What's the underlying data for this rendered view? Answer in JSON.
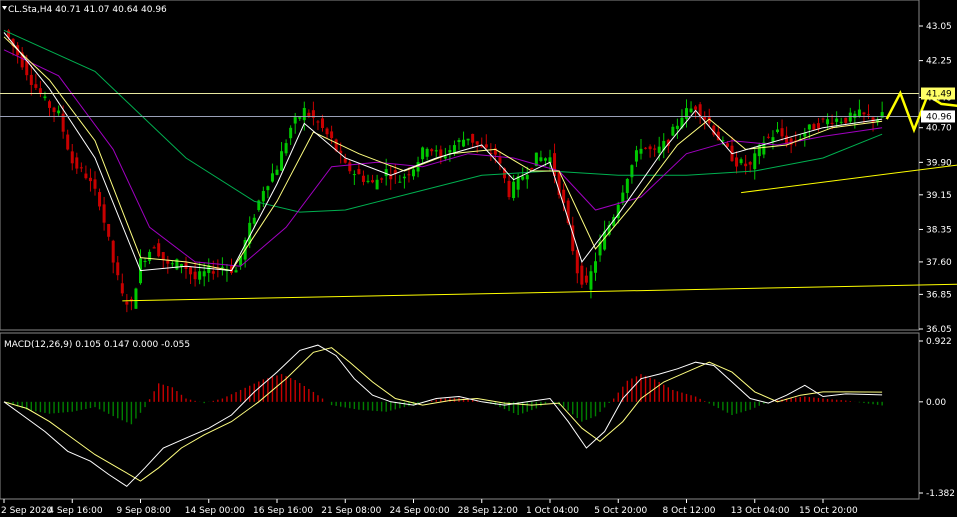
{
  "header": {
    "symbol_line": "CL.Sta,H4  40.71 41.07 40.64 40.96"
  },
  "macd_header": {
    "text": "MACD(12,26,9) 0.105 0.147 0.000 -0.055"
  },
  "colors": {
    "background": "#000000",
    "frame": "#ffffff",
    "bull": "#00c800",
    "bear": "#c80000",
    "ma_fast": "#ffffff",
    "ma_mid": "#ffff80",
    "ma_slow": "#a000c0",
    "ma_long": "#00b050",
    "trend": "#ffff00",
    "hline": "#e8e8a0",
    "projection": "#ffff00",
    "macd_pos": "#c80000",
    "macd_neg": "#008000",
    "macd_line": "#ffffff",
    "signal_line": "#ffff80"
  },
  "chart_data": [
    {
      "type": "candlestick",
      "name_text": "CL.Sta,H4",
      "ylim": [
        36.05,
        43.05
      ],
      "yticks": [
        "43.05",
        "42.25",
        "41.40",
        "40.70",
        "39.90",
        "39.15",
        "38.35",
        "37.60",
        "36.85",
        "36.05"
      ],
      "ytick_values": [
        43.05,
        42.25,
        41.4,
        40.7,
        39.9,
        39.15,
        38.35,
        37.6,
        36.85,
        36.05
      ],
      "price_labels": [
        {
          "value": 41.49,
          "text": "41.49",
          "style": "hline"
        },
        {
          "value": 40.96,
          "text": "40.96",
          "style": "current"
        }
      ],
      "xticks": [
        "2 Sep 2020",
        "4 Sep 16:00",
        "9 Sep 08:00",
        "14 Sep 00:00",
        "16 Sep 16:00",
        "21 Sep 08:00",
        "24 Sep 00:00",
        "28 Sep 12:00",
        "1 Oct 04:00",
        "5 Oct 20:00",
        "8 Oct 12:00",
        "13 Oct 04:00",
        "15 Oct 20:00"
      ],
      "xtick_index": [
        0,
        15,
        30,
        45,
        60,
        75,
        90,
        105,
        120,
        135,
        150,
        165,
        180
      ],
      "close_path": [
        [
          0,
          42.95
        ],
        [
          3,
          42.4
        ],
        [
          6,
          41.8
        ],
        [
          9,
          41.3
        ],
        [
          12,
          41.0
        ],
        [
          15,
          39.9
        ],
        [
          18,
          39.6
        ],
        [
          21,
          39.0
        ],
        [
          24,
          37.6
        ],
        [
          26,
          36.8
        ],
        [
          28,
          36.6
        ],
        [
          30,
          37.6
        ],
        [
          33,
          38.0
        ],
        [
          36,
          37.5
        ],
        [
          39,
          37.6
        ],
        [
          42,
          37.2
        ],
        [
          45,
          37.4
        ],
        [
          48,
          37.5
        ],
        [
          51,
          37.4
        ],
        [
          54,
          38.4
        ],
        [
          57,
          39.3
        ],
        [
          60,
          39.8
        ],
        [
          63,
          40.7
        ],
        [
          66,
          41.1
        ],
        [
          69,
          40.8
        ],
        [
          72,
          40.4
        ],
        [
          75,
          39.8
        ],
        [
          78,
          39.6
        ],
        [
          81,
          39.4
        ],
        [
          84,
          39.7
        ],
        [
          87,
          39.5
        ],
        [
          90,
          39.8
        ],
        [
          93,
          40.3
        ],
        [
          96,
          40.0
        ],
        [
          99,
          40.3
        ],
        [
          102,
          40.5
        ],
        [
          105,
          40.2
        ],
        [
          108,
          40.1
        ],
        [
          111,
          39.2
        ],
        [
          114,
          39.6
        ],
        [
          117,
          40.0
        ],
        [
          120,
          40.0
        ],
        [
          123,
          38.9
        ],
        [
          126,
          37.4
        ],
        [
          128,
          37.0
        ],
        [
          131,
          38.0
        ],
        [
          134,
          38.7
        ],
        [
          137,
          39.6
        ],
        [
          140,
          40.3
        ],
        [
          143,
          40.1
        ],
        [
          146,
          40.4
        ],
        [
          149,
          41.0
        ],
        [
          152,
          41.2
        ],
        [
          155,
          40.8
        ],
        [
          158,
          40.3
        ],
        [
          161,
          39.9
        ],
        [
          164,
          39.8
        ],
        [
          167,
          40.4
        ],
        [
          170,
          40.6
        ],
        [
          173,
          40.3
        ],
        [
          176,
          40.6
        ],
        [
          179,
          40.8
        ],
        [
          182,
          40.9
        ],
        [
          185,
          40.9
        ],
        [
          188,
          41.0
        ],
        [
          191,
          40.9
        ],
        [
          193,
          40.96
        ]
      ],
      "ma_fast_path": [
        [
          0,
          42.9
        ],
        [
          10,
          41.6
        ],
        [
          20,
          40.0
        ],
        [
          30,
          37.4
        ],
        [
          40,
          37.5
        ],
        [
          50,
          37.4
        ],
        [
          60,
          39.4
        ],
        [
          66,
          40.8
        ],
        [
          75,
          40.0
        ],
        [
          85,
          39.6
        ],
        [
          95,
          40.0
        ],
        [
          105,
          40.3
        ],
        [
          112,
          39.5
        ],
        [
          120,
          39.9
        ],
        [
          127,
          37.6
        ],
        [
          135,
          38.7
        ],
        [
          145,
          40.2
        ],
        [
          152,
          41.1
        ],
        [
          160,
          40.1
        ],
        [
          170,
          40.4
        ],
        [
          180,
          40.7
        ],
        [
          193,
          40.9
        ]
      ],
      "ma_mid_path": [
        [
          0,
          42.8
        ],
        [
          10,
          41.8
        ],
        [
          20,
          40.4
        ],
        [
          30,
          37.7
        ],
        [
          40,
          37.6
        ],
        [
          50,
          37.4
        ],
        [
          60,
          39.0
        ],
        [
          68,
          40.6
        ],
        [
          78,
          40.1
        ],
        [
          88,
          39.7
        ],
        [
          98,
          40.1
        ],
        [
          108,
          40.2
        ],
        [
          116,
          39.7
        ],
        [
          122,
          39.7
        ],
        [
          130,
          37.9
        ],
        [
          138,
          38.9
        ],
        [
          148,
          40.3
        ],
        [
          155,
          40.9
        ],
        [
          163,
          40.2
        ],
        [
          172,
          40.3
        ],
        [
          182,
          40.7
        ],
        [
          193,
          40.85
        ]
      ],
      "ma_slow_path": [
        [
          0,
          42.5
        ],
        [
          12,
          41.9
        ],
        [
          24,
          40.2
        ],
        [
          32,
          38.4
        ],
        [
          42,
          37.6
        ],
        [
          52,
          37.5
        ],
        [
          62,
          38.4
        ],
        [
          72,
          39.8
        ],
        [
          82,
          39.9
        ],
        [
          92,
          39.8
        ],
        [
          102,
          40.1
        ],
        [
          112,
          40.0
        ],
        [
          122,
          39.7
        ],
        [
          130,
          38.8
        ],
        [
          140,
          39.1
        ],
        [
          150,
          40.1
        ],
        [
          160,
          40.4
        ],
        [
          170,
          40.3
        ],
        [
          180,
          40.5
        ],
        [
          193,
          40.7
        ]
      ],
      "ma_long_path": [
        [
          0,
          42.95
        ],
        [
          20,
          42.0
        ],
        [
          40,
          40.0
        ],
        [
          55,
          39.0
        ],
        [
          65,
          38.75
        ],
        [
          75,
          38.8
        ],
        [
          90,
          39.2
        ],
        [
          105,
          39.6
        ],
        [
          120,
          39.7
        ],
        [
          135,
          39.6
        ],
        [
          150,
          39.6
        ],
        [
          165,
          39.7
        ],
        [
          180,
          40.0
        ],
        [
          193,
          40.55
        ]
      ],
      "trend_lines": [
        [
          [
            26,
            36.7
          ],
          [
            218,
            37.1
          ]
        ],
        [
          [
            162,
            39.2
          ],
          [
            218,
            39.95
          ]
        ]
      ],
      "hlines": [
        41.49,
        40.96
      ],
      "projection_path": [
        [
          194,
          40.9
        ],
        [
          197,
          41.5
        ],
        [
          200,
          40.65
        ],
        [
          203,
          41.45
        ],
        [
          206,
          41.25
        ],
        [
          210,
          41.2
        ],
        [
          214,
          41.75
        ]
      ]
    },
    {
      "type": "macd",
      "ylim": [
        -1.382,
        0.922
      ],
      "yticks": [
        "0.922",
        "0.00",
        "-1.382"
      ],
      "ytick_values": [
        0.922,
        0.0,
        -1.382
      ],
      "hist_path": [
        [
          0,
          0.0
        ],
        [
          5,
          -0.12
        ],
        [
          10,
          -0.18
        ],
        [
          15,
          -0.15
        ],
        [
          20,
          -0.08
        ],
        [
          25,
          -0.25
        ],
        [
          28,
          -0.34
        ],
        [
          31,
          -0.08
        ],
        [
          34,
          0.28
        ],
        [
          37,
          0.22
        ],
        [
          40,
          0.05
        ],
        [
          44,
          -0.02
        ],
        [
          48,
          0.05
        ],
        [
          52,
          0.18
        ],
        [
          57,
          0.34
        ],
        [
          61,
          0.42
        ],
        [
          64,
          0.33
        ],
        [
          68,
          0.15
        ],
        [
          72,
          -0.05
        ],
        [
          78,
          -0.12
        ],
        [
          84,
          -0.15
        ],
        [
          88,
          -0.08
        ],
        [
          92,
          -0.02
        ],
        [
          96,
          0.05
        ],
        [
          100,
          0.06
        ],
        [
          104,
          0.02
        ],
        [
          108,
          -0.05
        ],
        [
          113,
          -0.2
        ],
        [
          117,
          -0.1
        ],
        [
          120,
          0.0
        ],
        [
          123,
          -0.08
        ],
        [
          127,
          -0.3
        ],
        [
          130,
          -0.22
        ],
        [
          134,
          0.05
        ],
        [
          137,
          0.32
        ],
        [
          140,
          0.42
        ],
        [
          143,
          0.34
        ],
        [
          147,
          0.18
        ],
        [
          152,
          0.08
        ],
        [
          156,
          -0.06
        ],
        [
          160,
          -0.2
        ],
        [
          164,
          -0.12
        ],
        [
          168,
          0.0
        ],
        [
          172,
          0.05
        ],
        [
          176,
          0.08
        ],
        [
          180,
          0.05
        ],
        [
          185,
          0.02
        ],
        [
          193,
          -0.055
        ]
      ],
      "macd_path": [
        [
          0,
          0.0
        ],
        [
          4,
          -0.2
        ],
        [
          9,
          -0.45
        ],
        [
          14,
          -0.75
        ],
        [
          19,
          -0.9
        ],
        [
          23,
          -1.1
        ],
        [
          27,
          -1.28
        ],
        [
          31,
          -1.0
        ],
        [
          35,
          -0.7
        ],
        [
          40,
          -0.55
        ],
        [
          45,
          -0.4
        ],
        [
          50,
          -0.2
        ],
        [
          55,
          0.15
        ],
        [
          60,
          0.45
        ],
        [
          65,
          0.78
        ],
        [
          69,
          0.86
        ],
        [
          73,
          0.7
        ],
        [
          77,
          0.35
        ],
        [
          81,
          0.1
        ],
        [
          85,
          0.0
        ],
        [
          90,
          -0.05
        ],
        [
          95,
          0.05
        ],
        [
          100,
          0.08
        ],
        [
          105,
          0.0
        ],
        [
          110,
          -0.05
        ],
        [
          115,
          0.0
        ],
        [
          120,
          0.05
        ],
        [
          124,
          -0.3
        ],
        [
          128,
          -0.7
        ],
        [
          132,
          -0.45
        ],
        [
          136,
          0.05
        ],
        [
          140,
          0.35
        ],
        [
          144,
          0.42
        ],
        [
          148,
          0.5
        ],
        [
          152,
          0.6
        ],
        [
          156,
          0.55
        ],
        [
          160,
          0.3
        ],
        [
          164,
          0.05
        ],
        [
          168,
          -0.02
        ],
        [
          172,
          0.1
        ],
        [
          176,
          0.25
        ],
        [
          180,
          0.08
        ],
        [
          185,
          0.12
        ],
        [
          193,
          0.105
        ]
      ],
      "signal_path": [
        [
          0,
          0.0
        ],
        [
          5,
          -0.1
        ],
        [
          10,
          -0.3
        ],
        [
          15,
          -0.55
        ],
        [
          20,
          -0.8
        ],
        [
          25,
          -1.0
        ],
        [
          30,
          -1.2
        ],
        [
          34,
          -1.0
        ],
        [
          39,
          -0.7
        ],
        [
          44,
          -0.5
        ],
        [
          50,
          -0.3
        ],
        [
          56,
          0.0
        ],
        [
          62,
          0.35
        ],
        [
          68,
          0.75
        ],
        [
          72,
          0.82
        ],
        [
          76,
          0.6
        ],
        [
          81,
          0.3
        ],
        [
          86,
          0.05
        ],
        [
          92,
          -0.05
        ],
        [
          98,
          0.02
        ],
        [
          104,
          0.05
        ],
        [
          110,
          -0.02
        ],
        [
          116,
          -0.05
        ],
        [
          122,
          -0.02
        ],
        [
          127,
          -0.4
        ],
        [
          131,
          -0.6
        ],
        [
          136,
          -0.3
        ],
        [
          140,
          0.05
        ],
        [
          145,
          0.3
        ],
        [
          150,
          0.45
        ],
        [
          155,
          0.6
        ],
        [
          160,
          0.45
        ],
        [
          165,
          0.15
        ],
        [
          170,
          0.0
        ],
        [
          175,
          0.1
        ],
        [
          180,
          0.15
        ],
        [
          186,
          0.15
        ],
        [
          193,
          0.147
        ]
      ]
    }
  ]
}
